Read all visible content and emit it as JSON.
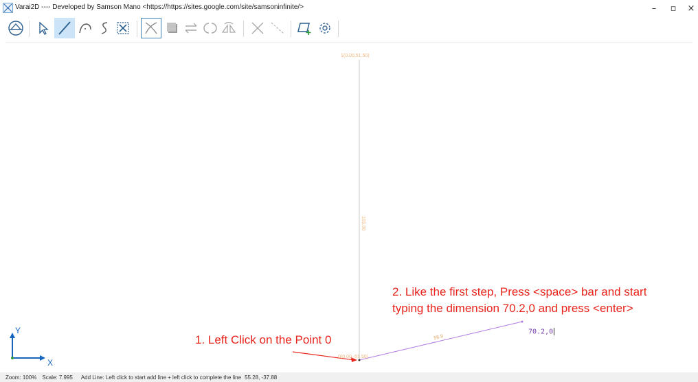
{
  "window": {
    "title": "Varai2D ---- Developed by Samson Mano <https://https://sites.google.com/site/samsoninfinite/>",
    "minimize_glyph": "–",
    "maximize_glyph": "▫",
    "close_glyph": "×"
  },
  "toolbar": {
    "tools": [
      {
        "name": "view-icon",
        "active": false
      },
      {
        "name": "select-icon",
        "active": false
      },
      {
        "name": "add-line-icon",
        "active": true
      },
      {
        "name": "add-arc-icon",
        "active": false
      },
      {
        "name": "add-curve-icon",
        "active": false
      },
      {
        "name": "select-box-icon",
        "active": false
      },
      {
        "name": "intersect-icon",
        "active": false
      },
      {
        "name": "fill-icon",
        "active": false
      },
      {
        "name": "mirror-icon",
        "active": false
      },
      {
        "name": "rotate-icon",
        "active": false
      },
      {
        "name": "flip-icon",
        "active": false
      },
      {
        "name": "delete-icon",
        "active": false
      },
      {
        "name": "trim-icon",
        "active": false
      },
      {
        "name": "add-surface-icon",
        "active": false
      },
      {
        "name": "settings-icon",
        "active": false
      }
    ]
  },
  "canvas": {
    "top_point_label": "1(0.00,51.50)",
    "bottom_point_label": "0(0.00,-51.50)",
    "vertical_dimension_label": "103.00",
    "new_line_dimension_label": "56.9",
    "command_input": "70.2,0",
    "axis_x_label": "X",
    "axis_y_label": "Y",
    "colors": {
      "point_label": "#f2b880",
      "vertical_line": "#c8c8c8",
      "new_line": "#b07adf",
      "annotation": "#e8241c",
      "axis": "#1565c0"
    }
  },
  "annotations": {
    "step1": "1. Left Click on the Point 0",
    "step2_line1": "2. Like the first step, Press <space> bar and start",
    "step2_line2": "typing the dimension 70.2,0 and press <enter>"
  },
  "status": {
    "zoom": "Zoom: 100%",
    "scale": "Scale: 7.995",
    "message": "Add Line: Left click to start add line + left click to complete the line",
    "coords": "55.28, -37.88"
  }
}
